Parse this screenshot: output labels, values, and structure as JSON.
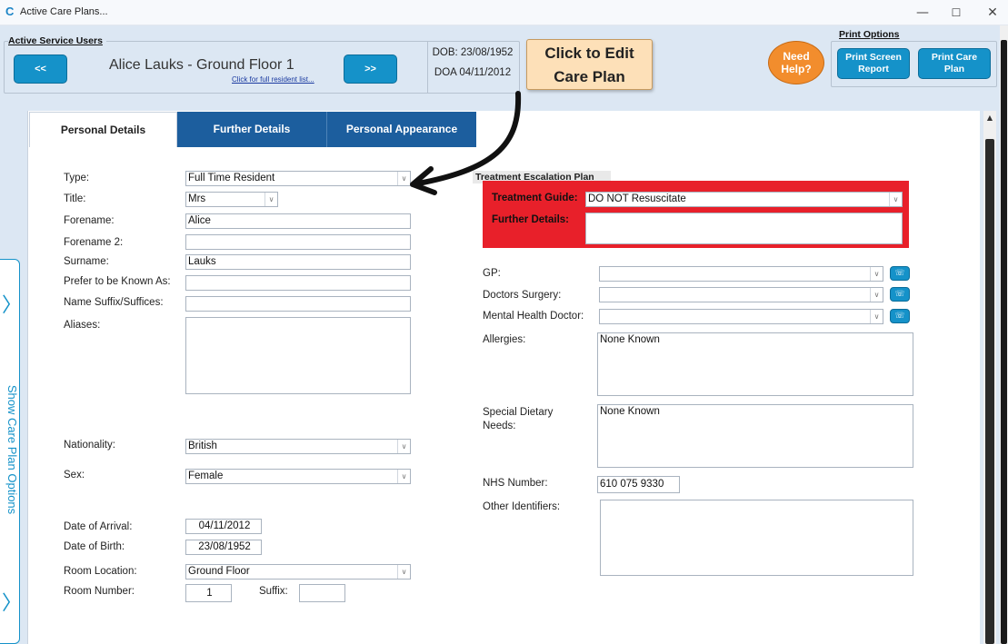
{
  "window": {
    "title": "Active Care Plans...",
    "minimize": "—",
    "maximize": "☐",
    "close": "✕",
    "app_icon": "C"
  },
  "header": {
    "group_label": "Active Service Users",
    "prev_label": "<<",
    "next_label": ">>",
    "resident_name": "Alice Lauks - Ground Floor 1",
    "resident_link": "Click for full resident list...",
    "dob": "DOB: 23/08/1952",
    "doa": "DOA 04/11/2012",
    "edit_line1": "Click to Edit",
    "edit_line2": "Care Plan",
    "help_line1": "Need",
    "help_line2": "Help?",
    "print_group_label": "Print Options",
    "print_screen_line1": "Print Screen",
    "print_screen_line2": "Report",
    "print_care_line1": "Print Care",
    "print_care_line2": "Plan"
  },
  "tabs": [
    {
      "label": "Personal Details",
      "active": true
    },
    {
      "label": "Further Details",
      "active": false
    },
    {
      "label": "Personal Appearance",
      "active": false
    }
  ],
  "left_form": {
    "type_label": "Type:",
    "type_value": "Full Time Resident",
    "title_label": "Title:",
    "title_value": "Mrs",
    "forename_label": "Forename:",
    "forename_value": "Alice",
    "forename2_label": "Forename 2:",
    "forename2_value": "",
    "surname_label": "Surname:",
    "surname_value": "Lauks",
    "known_as_label": "Prefer to be Known As:",
    "known_as_value": "",
    "suffix_label": "Name Suffix/Suffices:",
    "suffix_value": "",
    "aliases_label": "Aliases:",
    "aliases_value": "",
    "nationality_label": "Nationality:",
    "nationality_value": "British",
    "sex_label": "Sex:",
    "sex_value": "Female",
    "arrival_label": "Date of Arrival:",
    "arrival_value": "04/11/2012",
    "birth_label": "Date of Birth:",
    "birth_value": "23/08/1952",
    "room_location_label": "Room Location:",
    "room_location_value": "Ground Floor",
    "room_number_label": "Room Number:",
    "room_number_value": "1",
    "room_suffix_label": "Suffix:",
    "room_suffix_value": ""
  },
  "escalation": {
    "title": "Treatment Escalation Plan",
    "guide_label": "Treatment Guide:",
    "guide_value": "DO NOT Resuscitate",
    "details_label": "Further Details:",
    "details_value": ""
  },
  "right_form": {
    "gp_label": "GP:",
    "gp_value": "",
    "surgery_label": "Doctors Surgery:",
    "surgery_value": "",
    "mental_label": "Mental Health Doctor:",
    "mental_value": "",
    "allergies_label": "Allergies:",
    "allergies_value": "None Known",
    "dietary_label_line1": "Special Dietary",
    "dietary_label_line2": "Needs:",
    "dietary_value": "None Known",
    "nhs_label": "NHS Number:",
    "nhs_value": "610 075 9330",
    "other_label": "Other Identifiers:",
    "other_value": ""
  },
  "side_tab": {
    "label": "Show Care Plan Options"
  },
  "icons": {
    "phone": "☏",
    "dropdown": "∨",
    "chevron": "〉"
  },
  "colors": {
    "accent": "#1592c9",
    "tab_dark": "#1c5e9e",
    "escalation_red": "#e8202a",
    "edit_button": "#fde0b8",
    "help_button": "#f28d2d"
  }
}
